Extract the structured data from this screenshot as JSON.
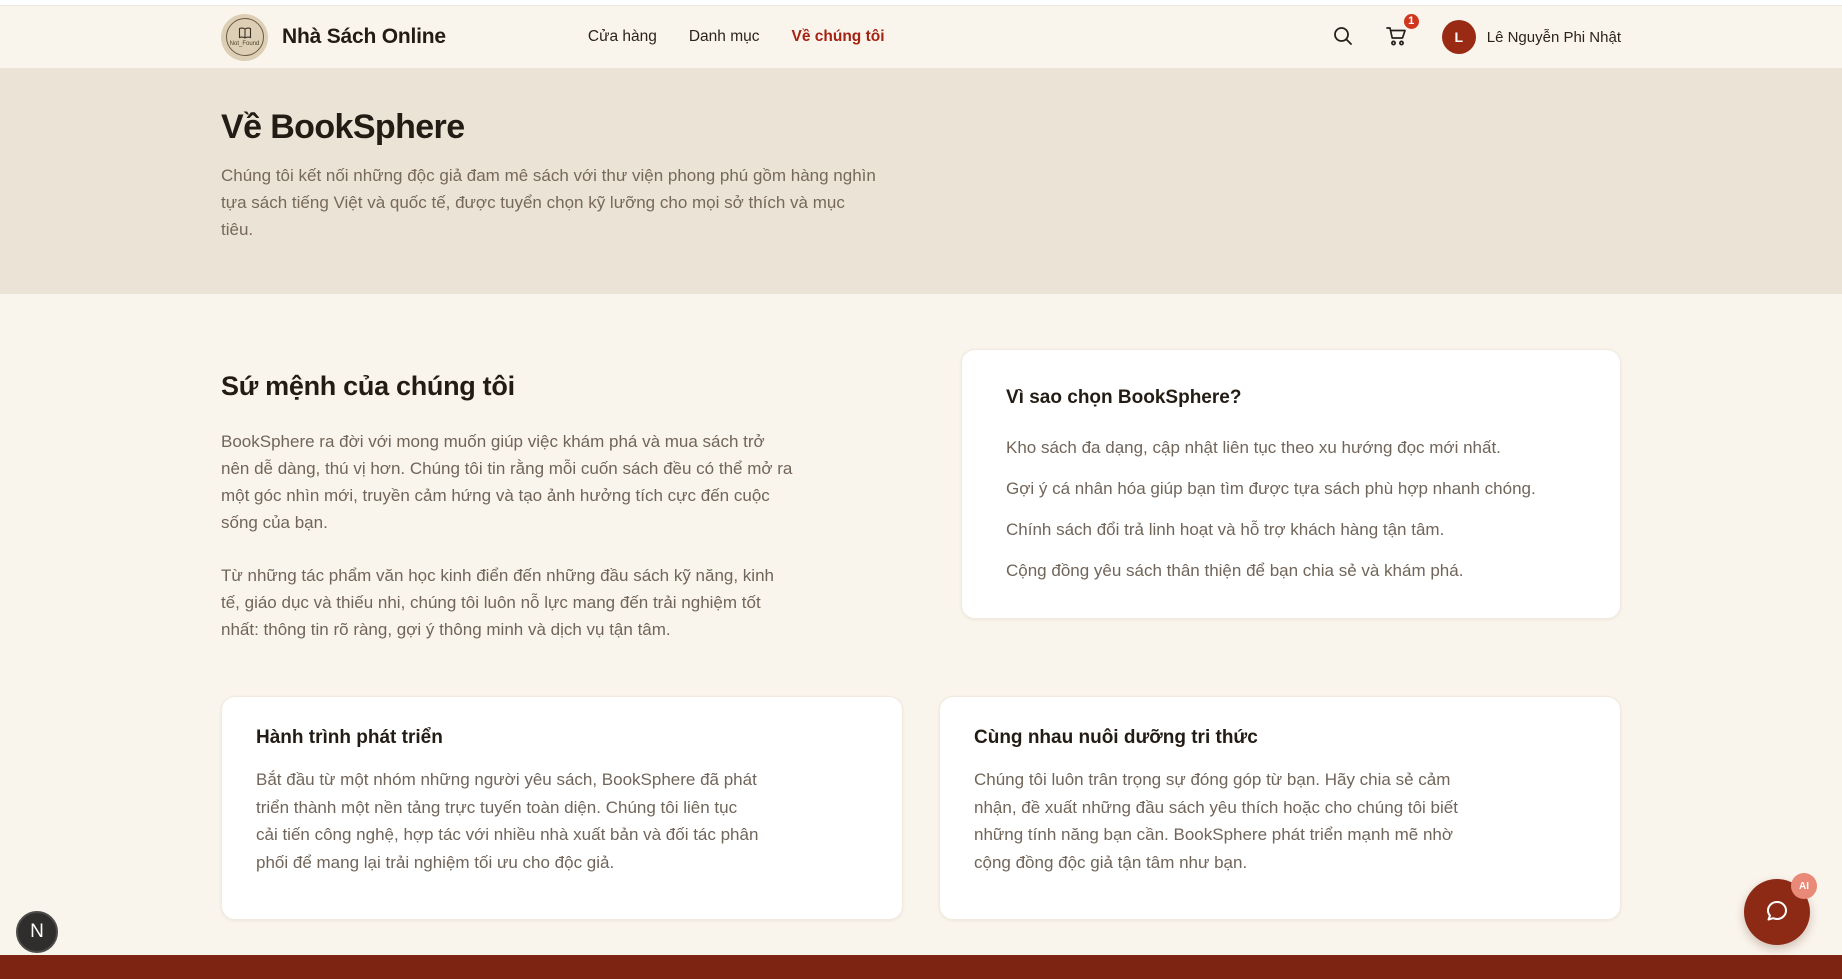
{
  "header": {
    "brand": "Nhà Sách Online",
    "logo_caption": "Not_Found",
    "nav": [
      {
        "label": "Cửa hàng",
        "active": false
      },
      {
        "label": "Danh mục",
        "active": false
      },
      {
        "label": "Về chúng tôi",
        "active": true
      }
    ],
    "cart_badge": "1",
    "avatar_initial": "L",
    "user_name": "Lê Nguyễn Phi Nhật"
  },
  "hero": {
    "title": "Về BookSphere",
    "description": "Chúng tôi kết nối những độc giả đam mê sách với thư viện phong phú gồm hàng nghìn tựa sách tiếng Việt và quốc tế, được tuyển chọn kỹ lưỡng cho mọi sở thích và mục tiêu."
  },
  "mission": {
    "title": "Sứ mệnh của chúng tôi",
    "paragraph1": "BookSphere ra đời với mong muốn giúp việc khám phá và mua sách trở nên dễ dàng, thú vị hơn. Chúng tôi tin rằng mỗi cuốn sách đều có thể mở ra một góc nhìn mới, truyền cảm hứng và tạo ảnh hưởng tích cực đến cuộc sống của bạn.",
    "paragraph2": "Từ những tác phẩm văn học kinh điển đến những đầu sách kỹ năng, kinh tế, giáo dục và thiếu nhi, chúng tôi luôn nỗ lực mang đến trải nghiệm tốt nhất: thông tin rõ ràng, gợi ý thông minh và dịch vụ tận tâm."
  },
  "why_card": {
    "title": "Vì sao chọn BookSphere?",
    "items": [
      "Kho sách đa dạng, cập nhật liên tục theo xu hướng đọc mới nhất.",
      "Gợi ý cá nhân hóa giúp bạn tìm được tựa sách phù hợp nhanh chóng.",
      "Chính sách đổi trả linh hoạt và hỗ trợ khách hàng tận tâm.",
      "Cộng đồng yêu sách thân thiện để bạn chia sẻ và khám phá."
    ]
  },
  "cards": [
    {
      "title": "Hành trình phát triển",
      "body": "Bắt đầu từ một nhóm những người yêu sách, BookSphere đã phát triển thành một nền tảng trực tuyến toàn diện. Chúng tôi liên tục cải tiến công nghệ, hợp tác với nhiều nhà xuất bản và đối tác phân phối để mang lại trải nghiệm tối ưu cho độc giả."
    },
    {
      "title": "Cùng nhau nuôi dưỡng tri thức",
      "body": "Chúng tôi luôn trân trọng sự đóng góp từ bạn. Hãy chia sẻ cảm nhận, đề xuất những đầu sách yêu thích hoặc cho chúng tôi biết những tính năng bạn cần. BookSphere phát triển mạnh mẽ nhờ cộng đồng độc giả tận tâm như bạn."
    }
  ],
  "floating": {
    "dev_badge": "N",
    "chat_badge": "AI"
  },
  "icons": {
    "logo": "book-icon",
    "search": "search-icon",
    "cart": "shopping-cart-icon",
    "chat": "chat-bubble-icon"
  },
  "colors": {
    "header_bg": "#faf5ec",
    "hero_bg": "#ebe3d6",
    "accent_red": "#a42312",
    "avatar_red": "#992b15",
    "cart_badge_red": "#d1371f",
    "footer_red": "#7e2413",
    "chat_button_red": "#8c2a16",
    "ai_badge_salmon": "#e98977",
    "card_bg": "#ffffff",
    "body_text": "#71655a",
    "heading_text": "#221c15"
  }
}
